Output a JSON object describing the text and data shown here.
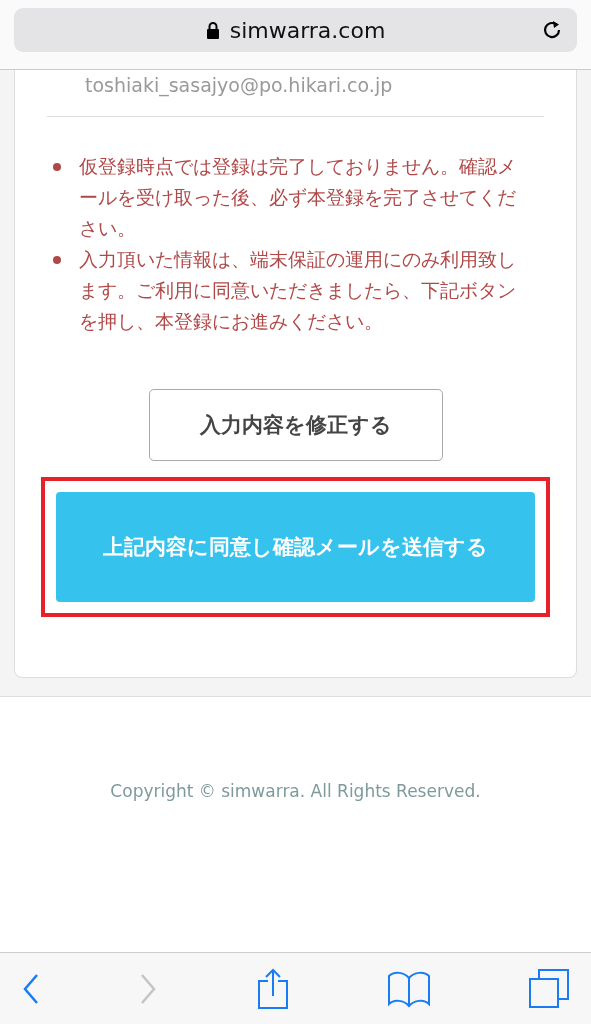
{
  "address_bar": {
    "url": "simwarra.com",
    "secure": true
  },
  "email": "toshiaki_sasajyo@po.hikari.co.jp",
  "notices": [
    "仮登録時点では登録は完了しておりません。確認メールを受け取った後、必ず本登録を完了させてください。",
    "入力頂いた情報は、端末保証の運用にのみ利用致します。ご利用に同意いただきましたら、下記ボタンを押し、本登録にお進みください。"
  ],
  "edit_button": "入力内容を修正する",
  "submit_button": {
    "label": "上記内容に同意し確認メールを送信する",
    "highlighted": true
  },
  "footer": "Copyright © simwarra. All Rights Reserved.",
  "toolbar": [
    {
      "kind": "back",
      "disabled": false
    },
    {
      "kind": "forward",
      "disabled": true
    },
    {
      "kind": "share",
      "disabled": false
    },
    {
      "kind": "bookmarks",
      "disabled": false
    },
    {
      "kind": "tabs",
      "disabled": false
    }
  ]
}
